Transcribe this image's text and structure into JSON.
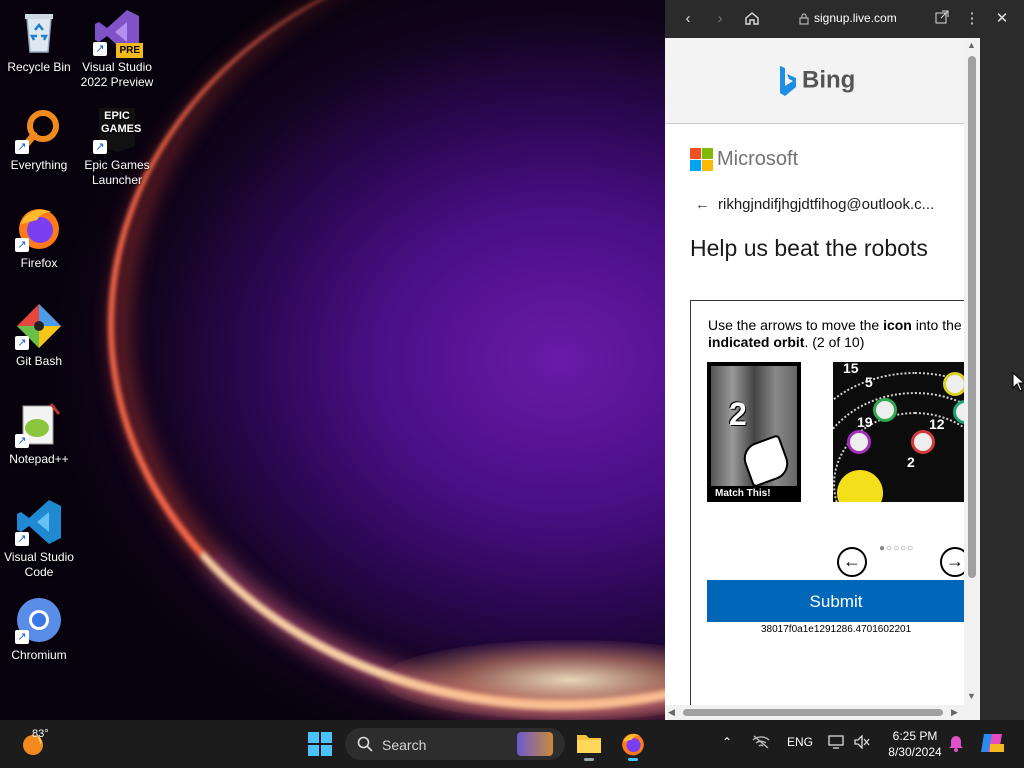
{
  "desktop": {
    "icons": [
      {
        "label": "Recycle Bin",
        "icon": "recycle-bin-icon"
      },
      {
        "label": "Visual Studio 2022 Preview",
        "icon": "visual-studio-preview-icon",
        "badge": "PRE"
      },
      {
        "label": "Everything",
        "icon": "everything-search-icon"
      },
      {
        "label": "Epic Games Launcher",
        "icon": "epic-games-icon",
        "logo_text": "EPIC GAMES"
      },
      {
        "label": "Firefox",
        "icon": "firefox-icon"
      },
      {
        "label": "Git Bash",
        "icon": "git-bash-icon"
      },
      {
        "label": "Notepad++",
        "icon": "notepad-plus-plus-icon"
      },
      {
        "label": "Visual Studio Code",
        "icon": "vscode-icon"
      },
      {
        "label": "Chromium",
        "icon": "chromium-icon"
      }
    ]
  },
  "browser": {
    "address": "signup.live.com",
    "bing_label": "Bing",
    "microsoft_label": "Microsoft",
    "email": "rikhgjndifjhgjdtfihog@outlook.c...",
    "title": "Help us beat the robots",
    "instruction": {
      "part1": "Use the arrows to move the ",
      "bold1": "icon",
      "part2": " into the ",
      "bold2": "indicated orbit",
      "part3": ". (2 of 10)"
    },
    "match_number": "2",
    "match_label": "Match This!",
    "orbit_numbers": [
      "15",
      "5",
      "19",
      "12",
      "2"
    ],
    "submit_label": "Submit",
    "token": "38017f0a1e1291286.4701602201"
  },
  "taskbar": {
    "weather_temp": "83°",
    "search_placeholder": "Search",
    "language": "ENG",
    "time": "6:25 PM",
    "date": "8/30/2024"
  },
  "colors": {
    "submit": "#0067b8",
    "taskbar": "#1c1c1c",
    "browser_chrome": "#2b2b2b"
  }
}
